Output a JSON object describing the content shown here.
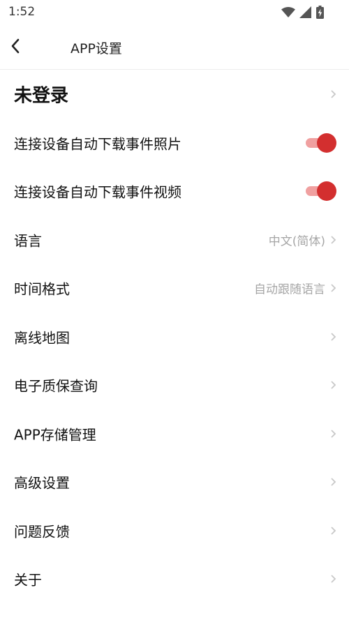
{
  "status_bar": {
    "time": "1:52",
    "icons": [
      "wifi-icon",
      "cellular-signal-icon",
      "battery-charging-icon"
    ]
  },
  "header": {
    "title": "APP设置",
    "back_icon": "chevron-left-icon"
  },
  "settings": {
    "login": {
      "label": "未登录"
    },
    "auto_photo": {
      "label": "连接设备自动下载事件照片",
      "enabled": true
    },
    "auto_video": {
      "label": "连接设备自动下载事件视频",
      "enabled": true
    },
    "language": {
      "label": "语言",
      "value": "中文(简体)"
    },
    "time_format": {
      "label": "时间格式",
      "value": "自动跟随语言"
    },
    "offline_map": {
      "label": "离线地图"
    },
    "warranty": {
      "label": "电子质保查询"
    },
    "storage": {
      "label": "APP存储管理"
    },
    "advanced": {
      "label": "高级设置"
    },
    "feedback": {
      "label": "问题反馈"
    },
    "about": {
      "label": "关于"
    }
  },
  "colors": {
    "toggle_knob": "#d32f2f",
    "toggle_track": "#f0a0a0",
    "chevron": "#c8c8c8",
    "secondary_text": "#a6a6a6"
  }
}
